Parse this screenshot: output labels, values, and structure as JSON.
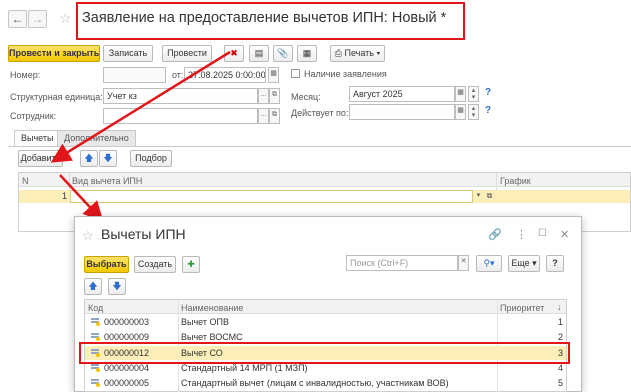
{
  "window": {
    "title": "Заявление на предоставление вычетов ИПН: Новый *"
  },
  "toolbar": {
    "post_close": "Провести и закрыть",
    "save": "Записать",
    "post": "Провести",
    "print": "Печать"
  },
  "form": {
    "number_label": "Номер:",
    "number_value": "",
    "from_label": "от:",
    "date_value": "27.08.2025 0:00:00",
    "has_statement_label": "Наличие заявления",
    "unit_label": "Структурная единица:",
    "unit_value": "Учет кз",
    "month_label": "Месяц:",
    "month_value": "Август 2025",
    "employee_label": "Сотрудник:",
    "employee_value": "",
    "valid_label": "Действует по:",
    "valid_value": "",
    "help": "?"
  },
  "tabs": [
    "Вычеты",
    "Дополнительно"
  ],
  "tab_toolbar": {
    "add": "Добавить",
    "selection": "Подбор"
  },
  "grid": {
    "headers": [
      "N",
      "Вид вычета ИПН",
      "График"
    ],
    "row_number": "1"
  },
  "dialog": {
    "title": "Вычеты ИПН",
    "select": "Выбрать",
    "create": "Создать",
    "search_placeholder": "Поиск (Ctrl+F)",
    "more": "Еще",
    "help": "?",
    "headers": [
      "Код",
      "Наименование",
      "Приоритет"
    ],
    "sort_arrow": "↓",
    "rows": [
      {
        "code": "000000003",
        "name": "Вычет ОПВ",
        "priority": "1"
      },
      {
        "code": "000000009",
        "name": "Вычет ВОСМС",
        "priority": "2"
      },
      {
        "code": "000000012",
        "name": "Вычет СО",
        "priority": "3"
      },
      {
        "code": "000000004",
        "name": "Стандартный 14 МРП (1 МЗП)",
        "priority": "4"
      },
      {
        "code": "000000005",
        "name": "Стандартный вычет (лицам с инвалидностью, участникам ВОВ)",
        "priority": "5"
      }
    ]
  },
  "colors": {
    "accent_yellow": "#f5c900",
    "highlight_red": "#e0161b",
    "selected_row": "#fbeeb8"
  }
}
